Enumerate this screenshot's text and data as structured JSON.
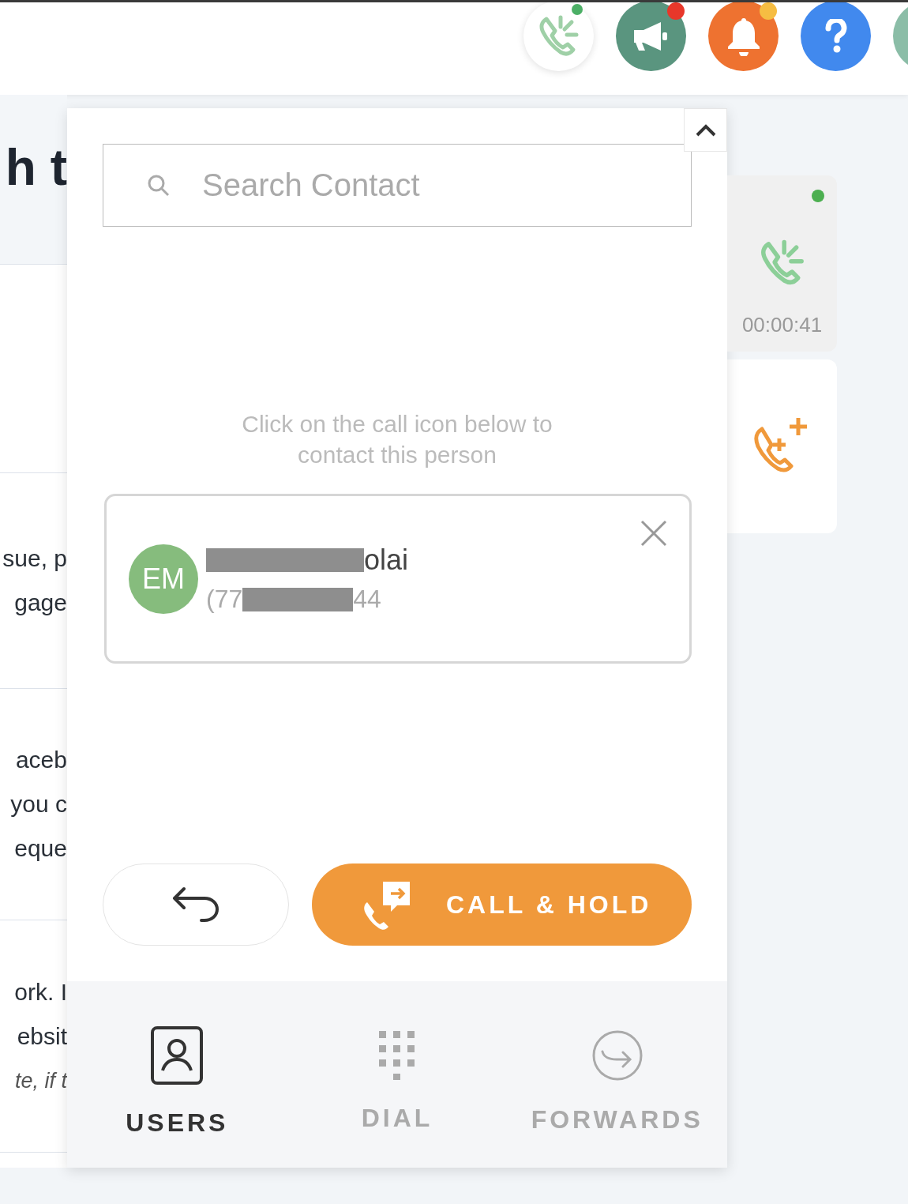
{
  "top_bar": {
    "buttons": [
      {
        "kind": "call",
        "color": "#ffffff",
        "badge": {
          "color": "#4caf66"
        }
      },
      {
        "kind": "announce",
        "color": "#5a957f",
        "badge": {
          "color": "#e8372a"
        }
      },
      {
        "kind": "bell",
        "color": "#ee7230",
        "badge": {
          "color": "#f6bd42"
        }
      },
      {
        "kind": "help",
        "color": "#4189ee"
      },
      {
        "kind": "partial",
        "color": "#8bbda7"
      }
    ]
  },
  "background": {
    "heading": "h t",
    "rows": [
      {
        "lines": []
      },
      {
        "lines": [
          "sue, p",
          "gage"
        ]
      },
      {
        "lines": [
          "aceb",
          "you c",
          "eque"
        ]
      },
      {
        "lines": [
          "ork. I",
          "ebsit"
        ],
        "note": "te, if t"
      }
    ]
  },
  "panel": {
    "search": {
      "placeholder": "Search Contact"
    },
    "hint": "Click on the call icon below to contact this person",
    "contact": {
      "initials": "EM",
      "name_end": "olai",
      "phone_start": "(77",
      "phone_end": "44"
    },
    "call_hold": "CALL & HOLD",
    "tabs": [
      {
        "label": "USERS",
        "kind": "users",
        "selected": true
      },
      {
        "label": "DIAL",
        "kind": "dial",
        "selected": false
      },
      {
        "label": "FORWARDS",
        "kind": "forwards",
        "selected": false
      }
    ]
  },
  "call_card": {
    "timer": "00:00:41",
    "online": true
  }
}
